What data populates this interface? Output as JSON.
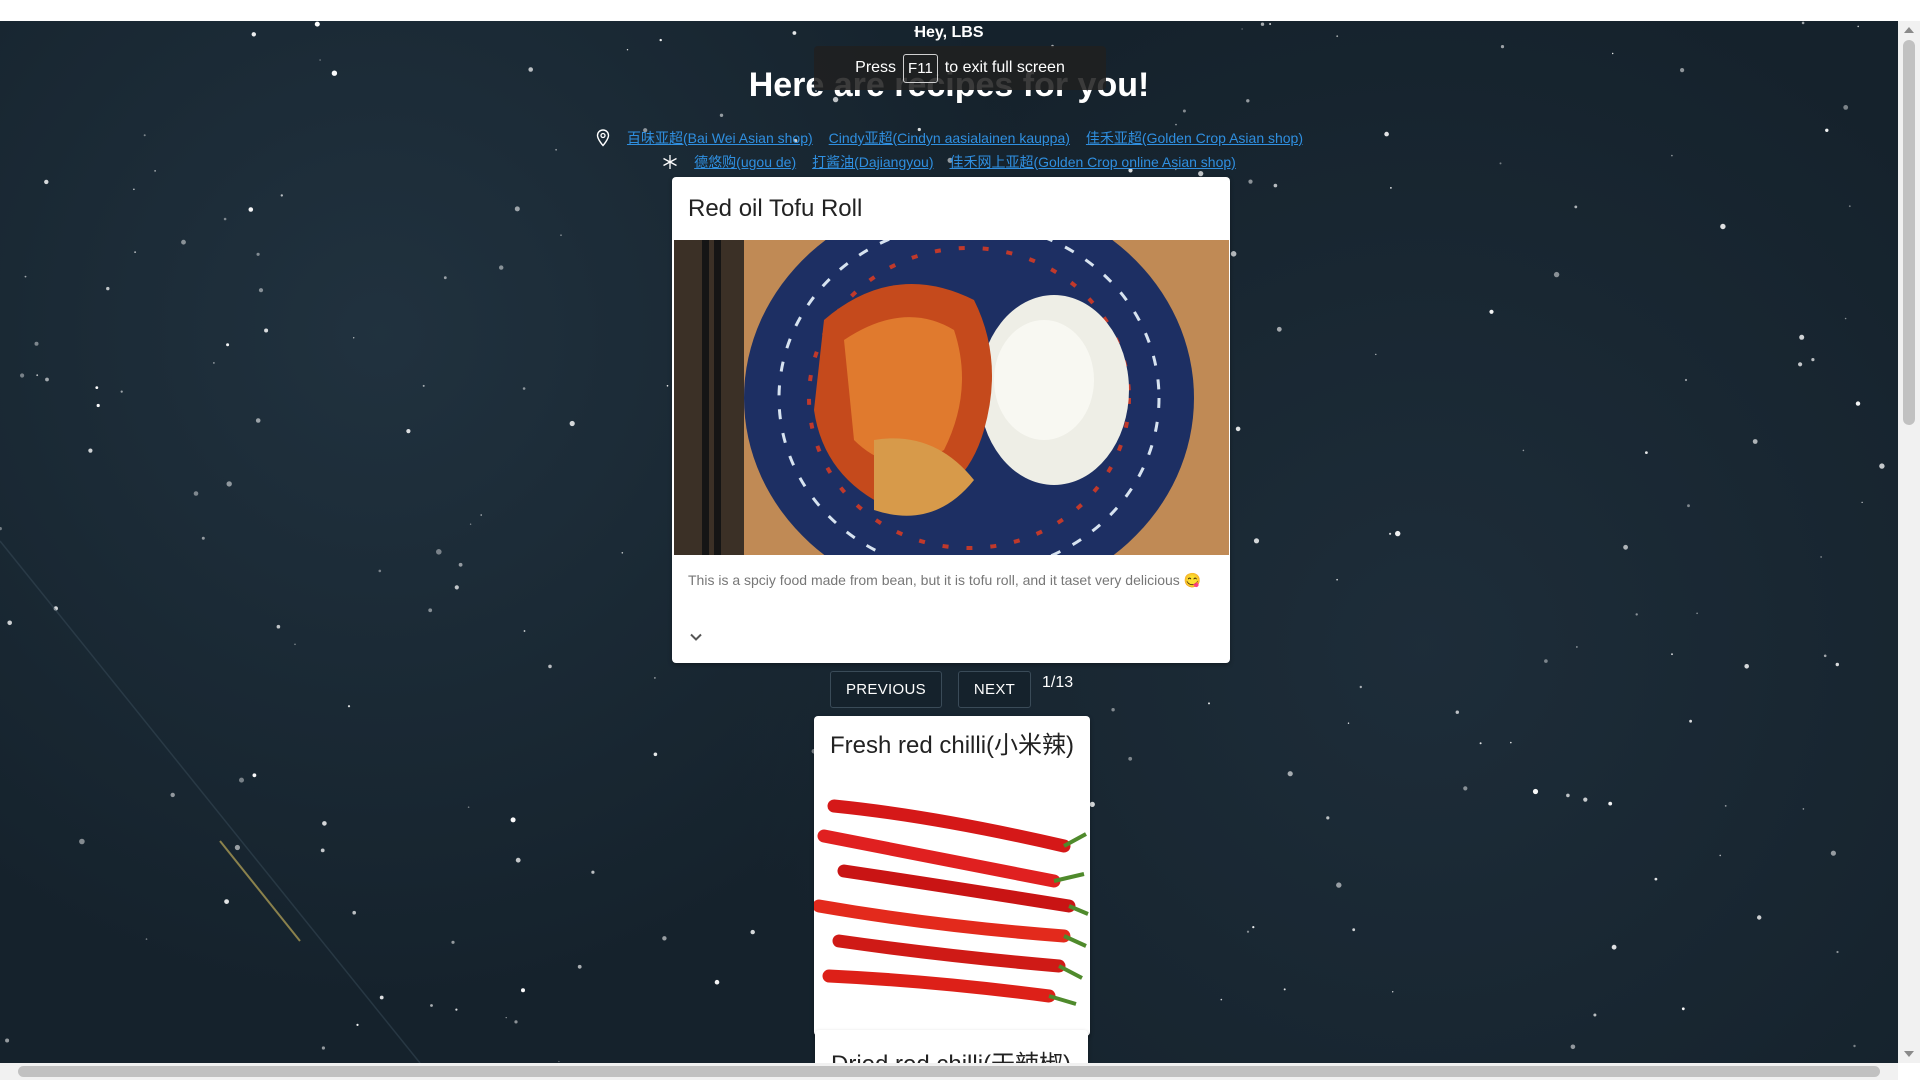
{
  "greeting": "Hey, LBS",
  "headline": "Here are recipes for you!",
  "fullscreen_toast": {
    "press": "Press",
    "key": "F11",
    "suffix": "to exit full screen"
  },
  "shops": {
    "physical": [
      "百味亚超(Bai Wei Asian shop)",
      "Cindy亚超(Cindyn aasialainen kauppa)",
      "佳禾亚超(Golden Crop Asian shop)"
    ],
    "online": [
      "德悠购(ugou de)",
      "打酱油(Dajiangyou)",
      "佳禾网上亚超(Golden Crop online Asian shop)"
    ]
  },
  "recipe_card": {
    "title": "Red oil Tofu Roll",
    "description": "This is a spciy food made from bean, but it is tofu roll, and it taset very delicious 😋"
  },
  "pager": {
    "previous": "PREVIOUS",
    "next": "NEXT",
    "count": "1/13"
  },
  "ingredients": [
    {
      "title": "Fresh red chilli(小米辣)"
    },
    {
      "title": "Dried red chilli(干辣椒)"
    }
  ],
  "colors": {
    "background": "#15222c",
    "link": "#2f8fe0",
    "card": "#ffffff"
  }
}
